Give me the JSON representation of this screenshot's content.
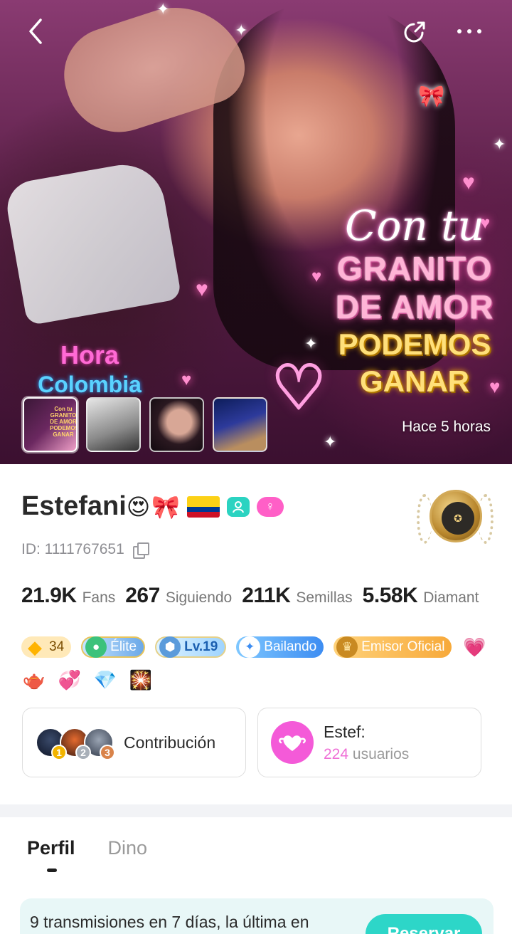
{
  "header": {
    "back_icon": "chevron-left-icon",
    "share_icon": "share-external-icon",
    "more_icon": "more-horizontal-icon"
  },
  "cover": {
    "promo_lines": [
      "Con tu",
      "GRANITO",
      "DE AMOR",
      "PODEMOS",
      "GANAR"
    ],
    "hora_line1": "Hora",
    "hora_line2": "Colombia",
    "time_ago": "Hace 5 horas",
    "thumbnails": [
      {
        "mini_text": "Con tu GRANITO DE AMOR PODEMOS GANAR"
      },
      {
        "mini_text": ""
      },
      {
        "mini_text": ""
      },
      {
        "mini_text": ""
      }
    ]
  },
  "profile": {
    "name": "Estefani",
    "name_emojis": [
      "😍",
      "🎀"
    ],
    "flag": "colombia-flag",
    "tags": [
      "teal-badge-icon",
      "gender-female-icon",
      "😰"
    ],
    "id_text": "ID: 1111767651",
    "stats": [
      {
        "value": "21.9K",
        "label": "Fans"
      },
      {
        "value": "267",
        "label": "Siguiendo"
      },
      {
        "value": "211K",
        "label": "Semillas"
      },
      {
        "value": "5.58K",
        "label": "Diamant"
      }
    ],
    "badges": {
      "diamond": "34",
      "elite": "Élite",
      "level": "Lv.19",
      "dance": "Bailando",
      "emisor": "Emisor Oficial"
    },
    "gifts": [
      "💗",
      "🫖",
      "💞",
      "💎",
      "🎇"
    ]
  },
  "cards": {
    "contribution_label": "Contribución",
    "ranks": [
      "1",
      "2",
      "3"
    ],
    "fan_club_title": "Estef:",
    "fan_club_count": "224",
    "fan_club_suffix": "usuarios"
  },
  "tabs": [
    {
      "label": "Perfil",
      "active": true
    },
    {
      "label": "Dino",
      "active": false
    }
  ],
  "banner": {
    "text": "9 transmisiones en 7 días, la última en",
    "button": "Reservar"
  }
}
